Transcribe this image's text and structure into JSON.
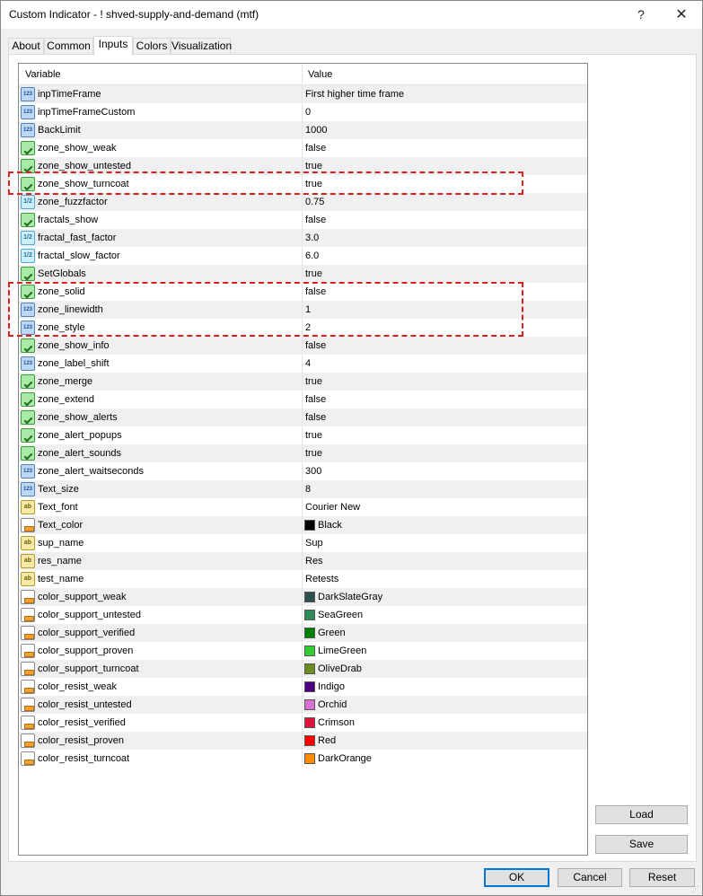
{
  "window": {
    "title": "Custom Indicator - ! shved-supply-and-demand (mtf)",
    "help_label": "?",
    "close_label": "✕"
  },
  "tabs": [
    {
      "label": "About"
    },
    {
      "label": "Common"
    },
    {
      "label": "Inputs",
      "active": true
    },
    {
      "label": "Colors"
    },
    {
      "label": "Visualization"
    }
  ],
  "grid": {
    "col_variable": "Variable",
    "col_value": "Value"
  },
  "rows": [
    {
      "icon": "int",
      "name": "inpTimeFrame",
      "value": "First higher time frame"
    },
    {
      "icon": "int",
      "name": "inpTimeFrameCustom",
      "value": "0"
    },
    {
      "icon": "int",
      "name": "BackLimit",
      "value": "1000"
    },
    {
      "icon": "bool",
      "name": "zone_show_weak",
      "value": "false"
    },
    {
      "icon": "bool",
      "name": "zone_show_untested",
      "value": "true"
    },
    {
      "icon": "bool",
      "name": "zone_show_turncoat",
      "value": "true"
    },
    {
      "icon": "dbl",
      "name": "zone_fuzzfactor",
      "value": "0.75"
    },
    {
      "icon": "bool",
      "name": "fractals_show",
      "value": "false"
    },
    {
      "icon": "dbl",
      "name": "fractal_fast_factor",
      "value": "3.0"
    },
    {
      "icon": "dbl",
      "name": "fractal_slow_factor",
      "value": "6.0"
    },
    {
      "icon": "bool",
      "name": "SetGlobals",
      "value": "true"
    },
    {
      "icon": "bool",
      "name": "zone_solid",
      "value": "false"
    },
    {
      "icon": "int",
      "name": "zone_linewidth",
      "value": "1"
    },
    {
      "icon": "int",
      "name": "zone_style",
      "value": "2"
    },
    {
      "icon": "bool",
      "name": "zone_show_info",
      "value": "false"
    },
    {
      "icon": "int",
      "name": "zone_label_shift",
      "value": "4"
    },
    {
      "icon": "bool",
      "name": "zone_merge",
      "value": "true"
    },
    {
      "icon": "bool",
      "name": "zone_extend",
      "value": "false"
    },
    {
      "icon": "bool",
      "name": "zone_show_alerts",
      "value": "false"
    },
    {
      "icon": "bool",
      "name": "zone_alert_popups",
      "value": "true"
    },
    {
      "icon": "bool",
      "name": "zone_alert_sounds",
      "value": "true"
    },
    {
      "icon": "int",
      "name": "zone_alert_waitseconds",
      "value": "300"
    },
    {
      "icon": "int",
      "name": "Text_size",
      "value": "8"
    },
    {
      "icon": "str",
      "name": "Text_font",
      "value": "Courier New"
    },
    {
      "icon": "col",
      "name": "Text_color",
      "value": "Black",
      "swatch": "#000000"
    },
    {
      "icon": "str",
      "name": "sup_name",
      "value": "Sup"
    },
    {
      "icon": "str",
      "name": "res_name",
      "value": "Res"
    },
    {
      "icon": "str",
      "name": "test_name",
      "value": "Retests"
    },
    {
      "icon": "col",
      "name": "color_support_weak",
      "value": "DarkSlateGray",
      "swatch": "#2f4f4f"
    },
    {
      "icon": "col",
      "name": "color_support_untested",
      "value": "SeaGreen",
      "swatch": "#2e8b57"
    },
    {
      "icon": "col",
      "name": "color_support_verified",
      "value": "Green",
      "swatch": "#008000"
    },
    {
      "icon": "col",
      "name": "color_support_proven",
      "value": "LimeGreen",
      "swatch": "#32cd32"
    },
    {
      "icon": "col",
      "name": "color_support_turncoat",
      "value": "OliveDrab",
      "swatch": "#6b8e23"
    },
    {
      "icon": "col",
      "name": "color_resist_weak",
      "value": "Indigo",
      "swatch": "#4b0082"
    },
    {
      "icon": "col",
      "name": "color_resist_untested",
      "value": "Orchid",
      "swatch": "#da70d6"
    },
    {
      "icon": "col",
      "name": "color_resist_verified",
      "value": "Crimson",
      "swatch": "#dc143c"
    },
    {
      "icon": "col",
      "name": "color_resist_proven",
      "value": "Red",
      "swatch": "#ff0000"
    },
    {
      "icon": "col",
      "name": "color_resist_turncoat",
      "value": "DarkOrange",
      "swatch": "#ff8c00"
    }
  ],
  "icon_labels": {
    "int": "123",
    "dbl": "1/2",
    "str": "ab",
    "bool": "",
    "col": ""
  },
  "buttons": {
    "load": "Load",
    "save": "Save",
    "ok": "OK",
    "cancel": "Cancel",
    "reset": "Reset"
  },
  "highlight_color": "#d9201f"
}
